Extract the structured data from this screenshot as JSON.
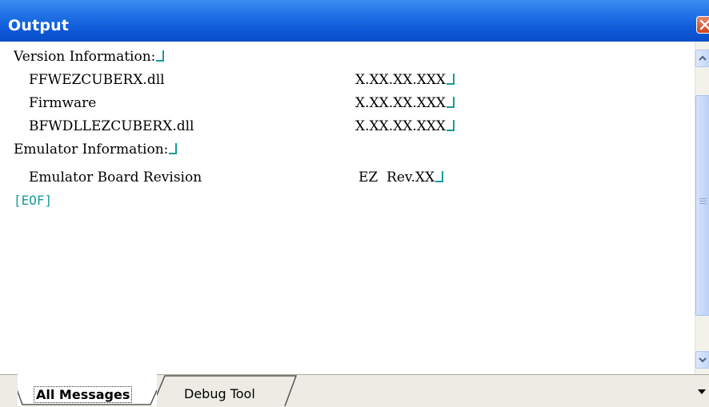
{
  "window": {
    "title": "Output"
  },
  "lines": {
    "version_heading": "Version Information:",
    "ffwez_name": "FFWEZCUBERX.dll",
    "ffwez_value": "X.XX.XX.XXX",
    "firmware_name": "Firmware",
    "firmware_value": "X.XX.XX.XXX",
    "bfwdll_name": "BFWDLLEZCUBERX.dll",
    "bfwdll_value": "X.XX.XX.XXX",
    "emulator_heading": "Emulator Information:",
    "board_revision_name": "Emulator Board Revision",
    "board_revision_value": "EZ  Rev.XX",
    "eof_marker": "[EOF]"
  },
  "tabs": [
    {
      "label": "All Messages",
      "active": true
    },
    {
      "label": "Debug Tool",
      "active": false
    }
  ],
  "colors": {
    "titlebar": "#0c57d6",
    "eol_marker": "#1a9a9a",
    "close_button": "#d2421c"
  },
  "icons": {
    "close": "close-icon",
    "scroll_up": "chevron-up-icon",
    "scroll_down": "chevron-down-icon",
    "tab_menu": "dropdown-arrow-icon"
  }
}
